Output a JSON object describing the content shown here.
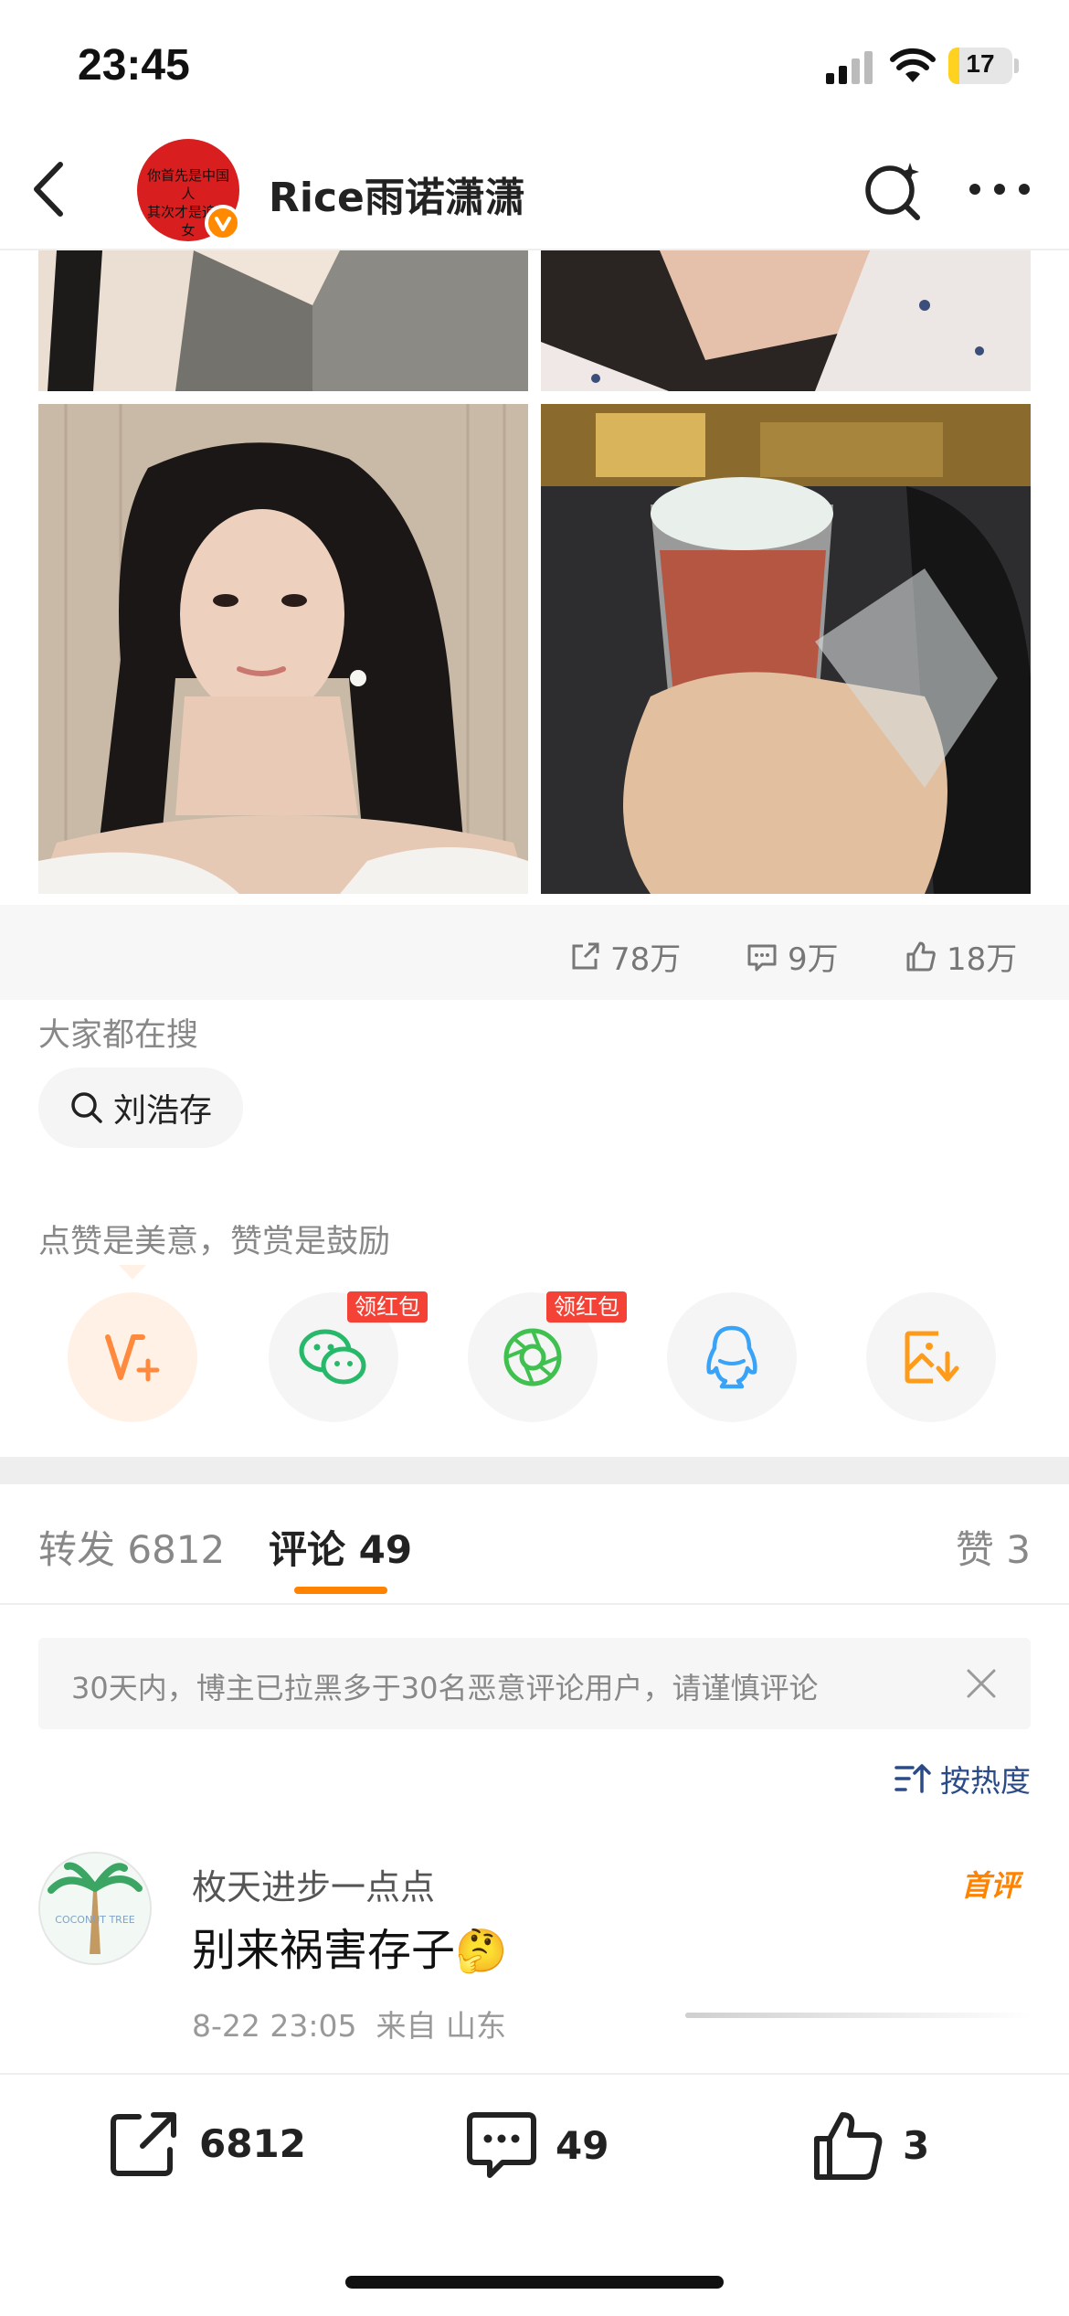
{
  "status_bar": {
    "time": "23:45",
    "battery": "17",
    "battery_level": 0.17
  },
  "header": {
    "avatar_text": "你首先是中国人\n其次才是追星女",
    "username": "Rice雨诺潇潇"
  },
  "photos": [
    {
      "name": "photo-top-left"
    },
    {
      "name": "photo-top-right"
    },
    {
      "name": "photo-portrait"
    },
    {
      "name": "photo-drink"
    }
  ],
  "post_stats": {
    "reposts": "78万",
    "comments": "9万",
    "likes": "18万"
  },
  "search_section": {
    "title": "大家都在搜",
    "chip_label": "刘浩存"
  },
  "reward_section": {
    "title": "点赞是美意，赞赏是鼓励",
    "red_packet_label": "领红包"
  },
  "share_icons": [
    "v-plus-icon",
    "wechat-icon",
    "moments-icon",
    "qq-icon",
    "save-image-icon"
  ],
  "tabs": {
    "repost": "转发 6812",
    "comment": "评论 49",
    "like": "赞 3"
  },
  "notice": {
    "text": "30天内，博主已拉黑多于30名恶意评论用户，请谨慎评论"
  },
  "sort": {
    "label": "按热度"
  },
  "comment": {
    "username": "枚天进步一点点",
    "text": "别来祸害存子",
    "emoji": "🤔",
    "meta": "8-22 23:05  来自 山东",
    "badge": "首评",
    "avatar_text": "COCONUT TREE"
  },
  "bottom_bar": {
    "repost_count": "6812",
    "comment_count": "49",
    "like_count": "3"
  },
  "colors": {
    "accent": "#ff8200",
    "link": "#2b4a88",
    "red_packet": "#f44336"
  }
}
